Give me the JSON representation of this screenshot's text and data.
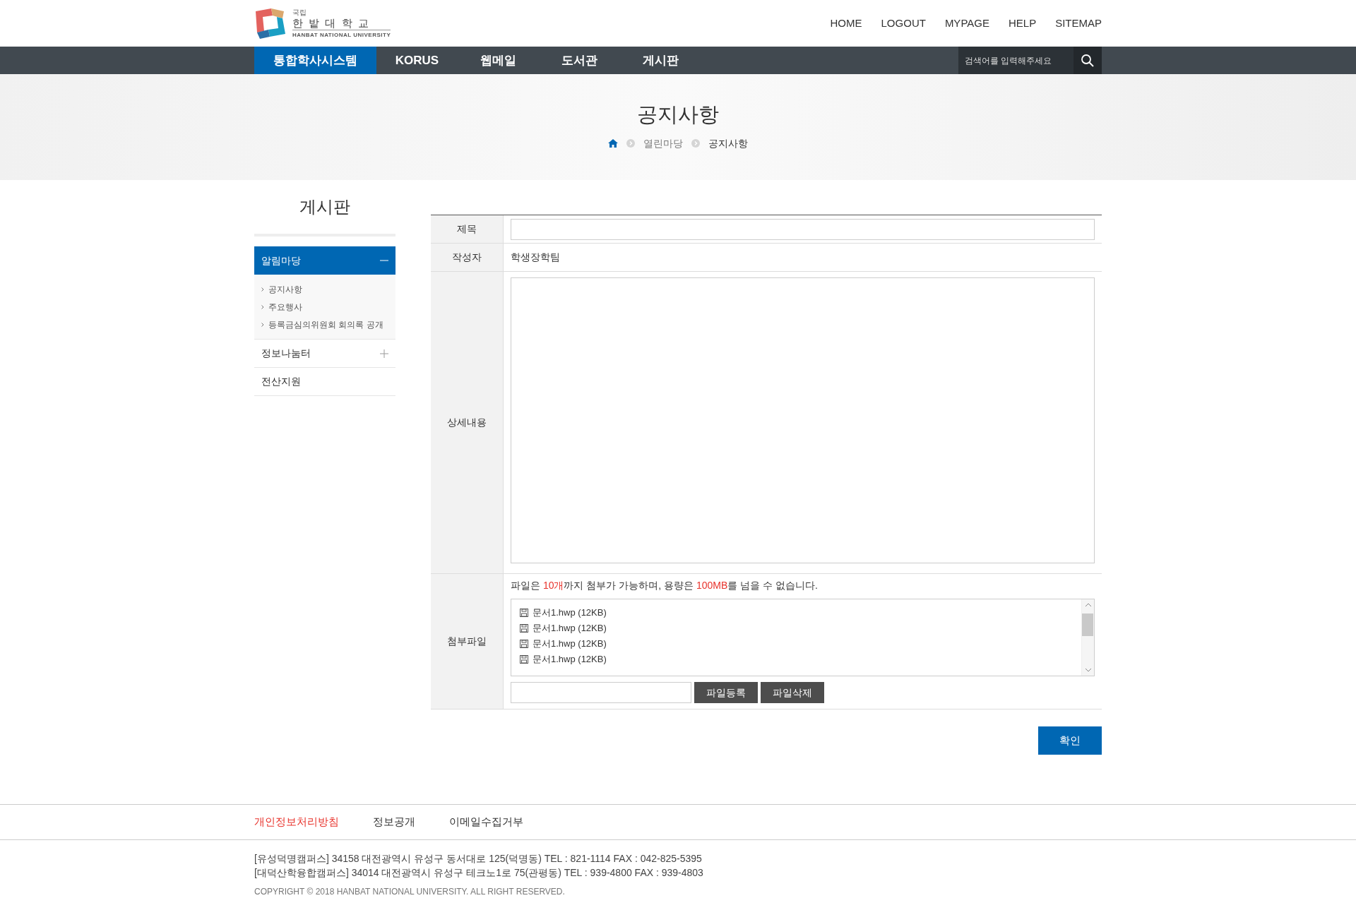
{
  "logo": {
    "small": "국립",
    "name": "한 밭 대 학 교",
    "english": "HANBAT NATIONAL UNIVERSITY"
  },
  "top_links": [
    "HOME",
    "LOGOUT",
    "MYPAGE",
    "HELP",
    "SITEMAP"
  ],
  "nav": [
    {
      "label": "통합학사시스템",
      "selected": true
    },
    {
      "label": "KORUS",
      "selected": false
    },
    {
      "label": "웹메일",
      "selected": false
    },
    {
      "label": "도서관",
      "selected": false
    },
    {
      "label": "게시판",
      "selected": false
    }
  ],
  "search": {
    "placeholder": "검색어를 입력해주세요"
  },
  "page_title": "공지사항",
  "breadcrumb": [
    "열린마당",
    "공지사항"
  ],
  "sidebar": {
    "title": "게시판",
    "groups": [
      {
        "label": "알림마당",
        "kind": "group",
        "expanded": true,
        "children": [
          {
            "label": "공지사항"
          },
          {
            "label": "주요행사"
          },
          {
            "label": "등록금심의위원회 회의록 공개"
          }
        ]
      },
      {
        "label": "정보나눔터",
        "kind": "group",
        "expanded": false
      },
      {
        "label": "전산지원",
        "kind": "link"
      }
    ]
  },
  "form": {
    "title": {
      "label": "제목"
    },
    "author": {
      "label": "작성자",
      "value": "학생장학팀"
    },
    "content": {
      "label": "상세내용"
    },
    "attachments": {
      "label": "첨부파일",
      "notice": [
        {
          "text": "파일은 ",
          "highlight": false
        },
        {
          "text": "10개",
          "highlight": true
        },
        {
          "text": "까지 첨부가 가능하며, 용량은 ",
          "highlight": false
        },
        {
          "text": "100MB",
          "highlight": true
        },
        {
          "text": "를 넘을 수 없습니다.",
          "highlight": false
        }
      ],
      "files": [
        "문서1.hwp (12KB)",
        "문서1.hwp (12KB)",
        "문서1.hwp (12KB)",
        "문서1.hwp (12KB)"
      ],
      "buttons": [
        "파일등록",
        "파일삭제"
      ]
    },
    "submit": "확인"
  },
  "footer": {
    "links": [
      {
        "label": "개인정보처리방침",
        "highlight": true
      },
      {
        "label": "정보공개",
        "highlight": false
      },
      {
        "label": "이메일수집거부",
        "highlight": false
      }
    ],
    "address": [
      "[유성덕명캠퍼스] 34158 대전광역시 유성구 동서대로 125(덕명동) TEL : 821-1114 FAX : 042-825-5395",
      "[대덕산학융합캠퍼스] 34014 대전광역시 유성구 테크노1로 75(관평동) TEL : 939-4800 FAX : 939-4803"
    ],
    "copyright": "COPYRIGHT © 2018 HANBAT NATIONAL UNIVERSITY. ALL RIGHT RESERVED."
  }
}
